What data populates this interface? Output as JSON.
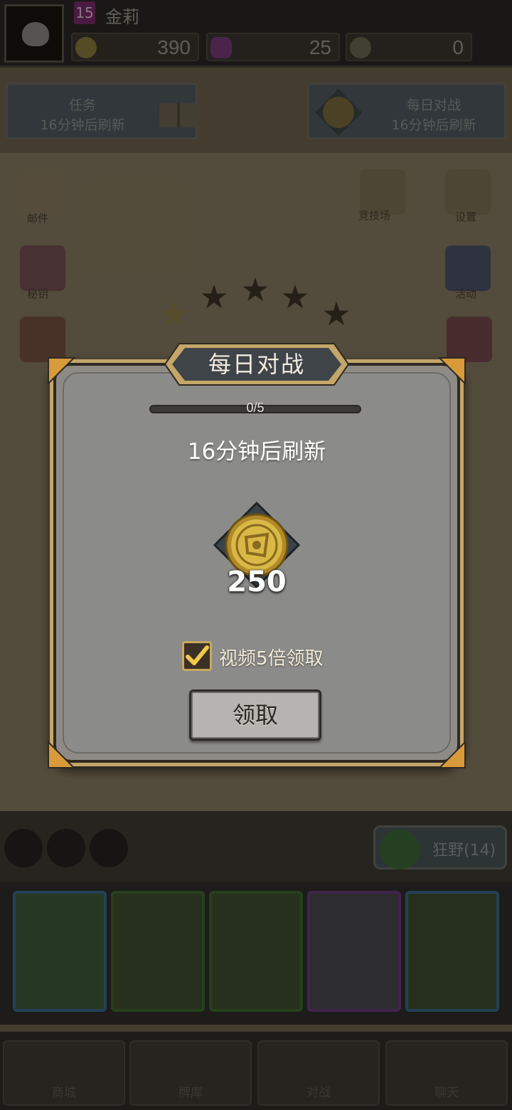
{
  "player": {
    "level": "15",
    "name": "金莉"
  },
  "resources": [
    {
      "icon": "gold-coin-icon",
      "value": "390"
    },
    {
      "icon": "gem-icon",
      "value": "25"
    },
    {
      "icon": "token-icon",
      "value": "0"
    }
  ],
  "top_buttons": {
    "quest": {
      "line1": "任务",
      "line2": "16分钟后刷新"
    },
    "daily": {
      "line1": "每日对战",
      "line2": "16分钟后刷新"
    }
  },
  "side_labels": {
    "left1": "邮件",
    "left2": "秘钥",
    "right1": "竞技场",
    "right2": "设置",
    "right3": "活动"
  },
  "wild_button": {
    "label": "狂野(14)"
  },
  "nav": [
    "商城",
    "牌库",
    "对战",
    "聊天"
  ],
  "modal": {
    "title": "每日对战",
    "progress_text": "0/5",
    "progress": 0,
    "refresh_text": "16分钟后刷新",
    "reward_amount": "250",
    "video_checkbox_checked": true,
    "video_label": "视频5倍领取",
    "claim_label": "领取"
  },
  "colors": {
    "frame_gold": "#c4a66a",
    "panel_grey": "#8b8b89",
    "coin_gold": "#d4b040"
  }
}
